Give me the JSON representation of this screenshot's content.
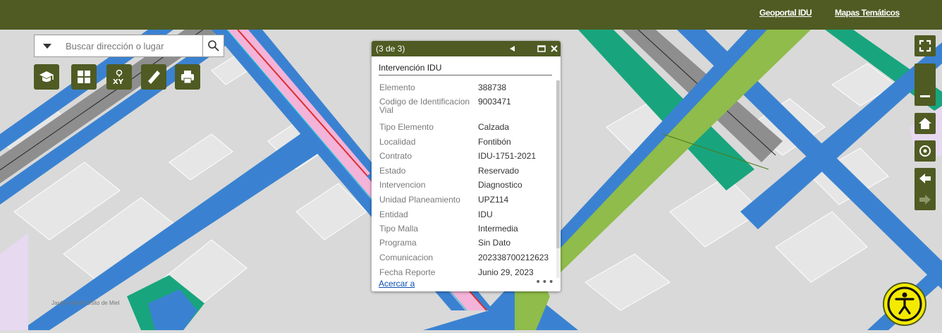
{
  "header": {
    "links": [
      "Geoportal IDU",
      "Mapas Temáticos"
    ]
  },
  "search": {
    "placeholder": "Buscar dirección o lugar"
  },
  "toolbar": {
    "tools": [
      "education-icon",
      "grid-icon",
      "xy-coordinates-icon",
      "ruler-icon",
      "print-icon"
    ]
  },
  "map_controls": [
    "fullscreen-icon",
    "zoom-out-icon",
    "home-icon",
    "locate-icon",
    "back-arrow-icon",
    "forward-arrow-icon"
  ],
  "popup": {
    "count": "(3 de 3)",
    "title": "Intervención IDU",
    "fields": [
      {
        "name": "Elemento",
        "value": "388738"
      },
      {
        "name": "Codigo de Identificacion Vial",
        "value": "9003471"
      },
      {
        "name": "Tipo Elemento",
        "value": "Calzada"
      },
      {
        "name": "Localidad",
        "value": "Fontibón"
      },
      {
        "name": "Contrato",
        "value": "IDU-1751-2021"
      },
      {
        "name": "Estado",
        "value": "Reservado"
      },
      {
        "name": "Intervencion",
        "value": "Diagnostico"
      },
      {
        "name": "Unidad Planeamiento",
        "value": "UPZ114"
      },
      {
        "name": "Entidad",
        "value": "IDU"
      },
      {
        "name": "Tipo Malla",
        "value": "Intermedia"
      },
      {
        "name": "Programa",
        "value": "Sin Dato"
      },
      {
        "name": "Comunicacion",
        "value": "202338700212623"
      },
      {
        "name": "Fecha Reporte",
        "value": "Junio 29, 2023"
      }
    ],
    "zoom_link": "Acercar a",
    "more": "•••"
  },
  "map": {
    "place_label": "Jardin Infantil Osito de Miel"
  },
  "colors": {
    "brand": "#4f5b23",
    "road_blue": "#3a82d1",
    "road_green": "#8fbc4a",
    "road_pink": "#f4b3d8",
    "road_teal": "#18a57d",
    "accessibility": "#f4ea00"
  }
}
